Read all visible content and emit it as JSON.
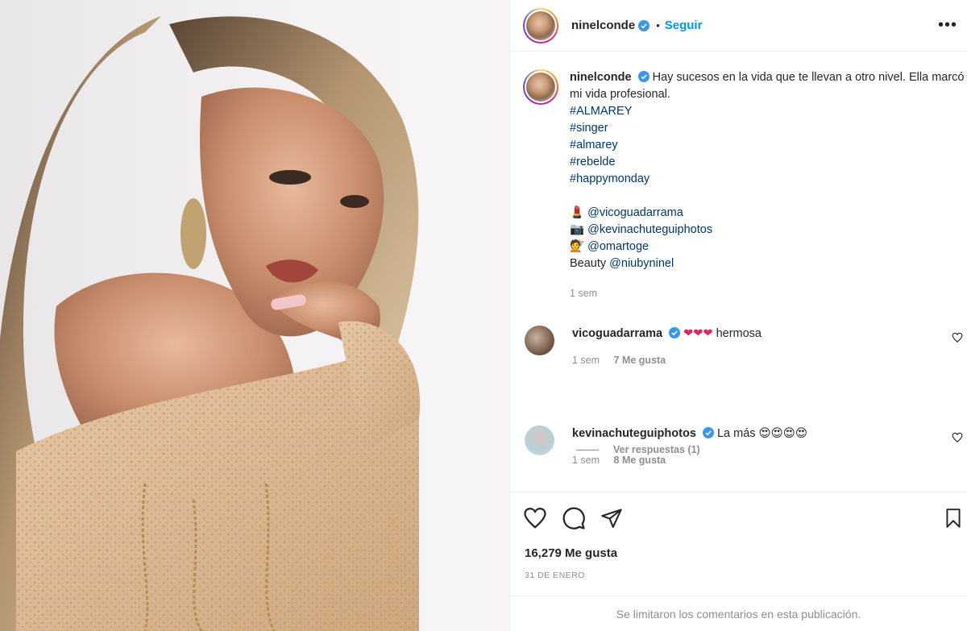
{
  "post": {
    "username": "ninelconde",
    "dot": "•",
    "follow_label": "Seguir",
    "more_label": "•••",
    "caption": {
      "username": "ninelconde",
      "text": "Hay sucesos en la vida que te llevan a otro nivel. Ella marcó mi vida profesional.",
      "hashtags": [
        "#ALMAREY",
        "#singer",
        "#almarey",
        "#rebelde",
        "#happymonday"
      ],
      "credits": [
        {
          "emoji": "💄",
          "prefix": "",
          "handle": "@vicoguadarrama"
        },
        {
          "emoji": "📷",
          "prefix": "",
          "handle": "@kevinachuteguiphotos"
        },
        {
          "emoji": "💇",
          "prefix": "",
          "handle": "@omartoge"
        },
        {
          "emoji": "",
          "prefix": "Beauty ",
          "handle": "@niubyninel"
        }
      ],
      "time": "1 sem"
    },
    "comments": [
      {
        "username": "vicoguadarrama",
        "emoji": "❤❤❤",
        "text": "hermosa",
        "time": "1 sem",
        "likes": "7 Me gusta"
      },
      {
        "username": "kevinachuteguiphotos",
        "text": "La más",
        "emoji": "😍😍😍😍",
        "time": "1 sem",
        "likes": "8 Me gusta"
      }
    ],
    "view_replies": "Ver respuestas (1)",
    "likes_count": "16,279 Me gusta",
    "date": "31 DE ENERO",
    "comments_limited": "Se limitaron los comentarios en esta publicación."
  },
  "colors": {
    "accent": "#0095f6",
    "link": "#00376b",
    "muted": "#8e8e8e",
    "verified": "#3897f0"
  },
  "icons": [
    "verified-badge-icon",
    "heart-icon",
    "comment-icon",
    "share-icon",
    "bookmark-icon",
    "more-options-icon"
  ]
}
